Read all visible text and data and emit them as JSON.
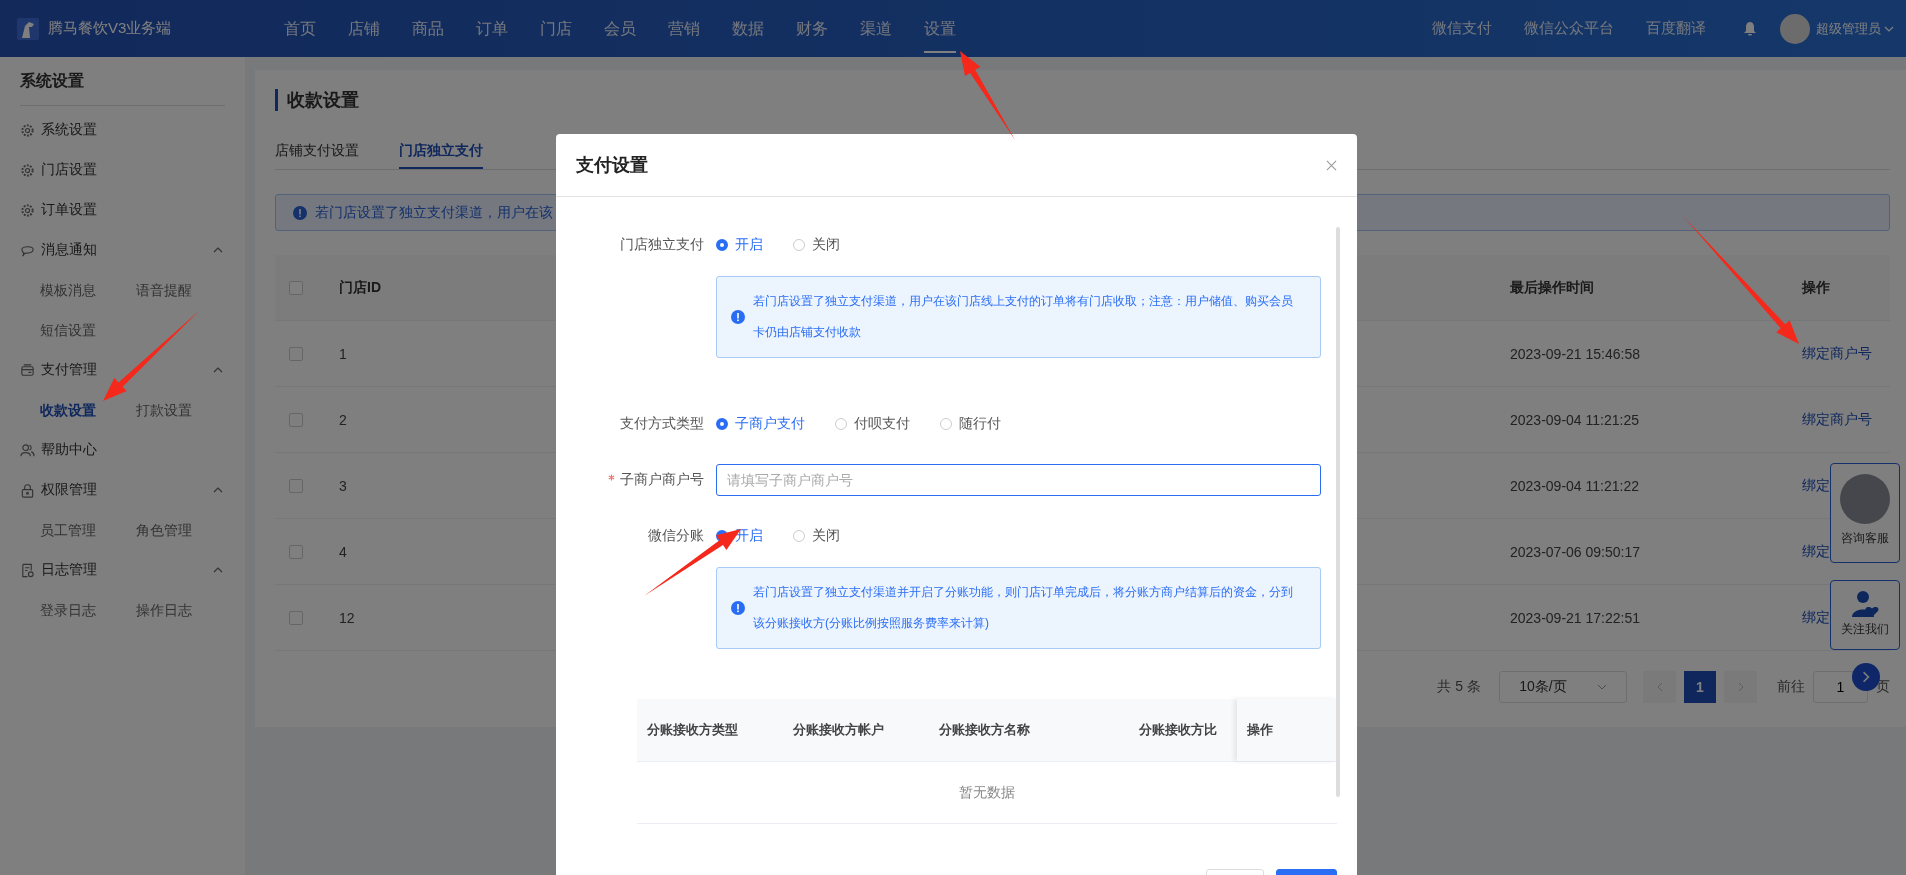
{
  "topbar": {
    "brand": "腾马餐饮V3业务端",
    "nav": [
      {
        "label": "首页",
        "selected": false
      },
      {
        "label": "店铺",
        "selected": false
      },
      {
        "label": "商品",
        "selected": false
      },
      {
        "label": "订单",
        "selected": false
      },
      {
        "label": "门店",
        "selected": false
      },
      {
        "label": "会员",
        "selected": false
      },
      {
        "label": "营销",
        "selected": false
      },
      {
        "label": "数据",
        "selected": false
      },
      {
        "label": "财务",
        "selected": false
      },
      {
        "label": "渠道",
        "selected": false
      },
      {
        "label": "设置",
        "selected": true
      }
    ],
    "links": [
      "微信支付",
      "微信公众平台",
      "百度翻译"
    ],
    "user": "超级管理员"
  },
  "sidebar": {
    "title": "系统设置",
    "items": [
      {
        "label": "系统设置"
      },
      {
        "label": "门店设置"
      },
      {
        "label": "订单设置"
      },
      {
        "label": "消息通知",
        "expanded": true,
        "children": [
          {
            "label": "模板消息",
            "selected": false
          },
          {
            "label": "语音提醒",
            "selected": false
          },
          {
            "label": "短信设置",
            "selected": false
          }
        ]
      },
      {
        "label": "支付管理",
        "expanded": true,
        "children": [
          {
            "label": "收款设置",
            "selected": true
          },
          {
            "label": "打款设置",
            "selected": false
          }
        ]
      },
      {
        "label": "帮助中心"
      },
      {
        "label": "权限管理",
        "expanded": true,
        "children": [
          {
            "label": "员工管理",
            "selected": false
          },
          {
            "label": "角色管理",
            "selected": false
          }
        ]
      },
      {
        "label": "日志管理",
        "expanded": true,
        "children": [
          {
            "label": "登录日志",
            "selected": false
          },
          {
            "label": "操作日志",
            "selected": false
          }
        ]
      }
    ]
  },
  "main": {
    "title": "收款设置",
    "tabs": [
      {
        "label": "店铺支付设置",
        "selected": false
      },
      {
        "label": "门店独立支付",
        "selected": true
      }
    ],
    "alert": "若门店设置了独立支付渠道，用户在该",
    "table": {
      "header_checked": false,
      "columns": [
        "门店ID",
        "最后操作时间",
        "操作"
      ],
      "rows": [
        {
          "checked": false,
          "id": "1",
          "time": "2023-09-21 15:46:58",
          "action": "绑定商户号"
        },
        {
          "checked": false,
          "id": "2",
          "time": "2023-09-04 11:21:25",
          "action": "绑定商户号"
        },
        {
          "checked": false,
          "id": "3",
          "time": "2023-09-04 11:21:22",
          "action": "绑定"
        },
        {
          "checked": false,
          "id": "4",
          "time": "2023-07-06 09:50:17",
          "action": "绑定"
        },
        {
          "checked": false,
          "id": "12",
          "time": "2023-09-21 17:22:51",
          "action": "绑定"
        }
      ]
    },
    "pagination": {
      "total": "共 5 条",
      "page_size": "10条/页",
      "pages": [
        {
          "label": "1",
          "selected": true
        }
      ],
      "goto_label": "前往",
      "goto_value": "1",
      "page_suffix": "页"
    }
  },
  "float_widgets": [
    {
      "kind": "photo",
      "label": "咨询客服"
    },
    {
      "kind": "icon",
      "label": "关注我们"
    }
  ],
  "modal": {
    "title": "支付设置",
    "form": [
      {
        "kind": "radio",
        "label": "门店独立支付",
        "options": [
          {
            "label": "开启",
            "selected": true
          },
          {
            "label": "关闭",
            "selected": false
          }
        ]
      },
      {
        "kind": "alert",
        "text": "若门店设置了独立支付渠道，用户在该门店线上支付的订单将有门店收取；注意：用户储值、购买会员卡仍由店铺支付收款"
      },
      {
        "kind": "radio",
        "label": "支付方式类型",
        "options": [
          {
            "label": "子商户支付",
            "selected": true
          },
          {
            "label": "付呗支付",
            "selected": false
          },
          {
            "label": "随行付",
            "selected": false
          }
        ]
      },
      {
        "kind": "input",
        "label": "子商户商户号",
        "required": true,
        "placeholder": "请填写子商户商户号"
      },
      {
        "kind": "radio",
        "label": "微信分账",
        "options": [
          {
            "label": "开启",
            "selected": true
          },
          {
            "label": "关闭",
            "selected": false
          }
        ]
      },
      {
        "kind": "alert",
        "text": "若门店设置了独立支付渠道并开启了分账功能，则门店订单完成后，将分账方商户结算后的资金，分到该分账接收方(分账比例按照服务费率来计算)"
      }
    ],
    "table": {
      "columns": [
        "分账接收方类型",
        "分账接收方帐户",
        "分账接收方名称",
        "分账接收方比"
      ],
      "fixed_column": "操作",
      "empty_text": "暂无数据"
    }
  }
}
